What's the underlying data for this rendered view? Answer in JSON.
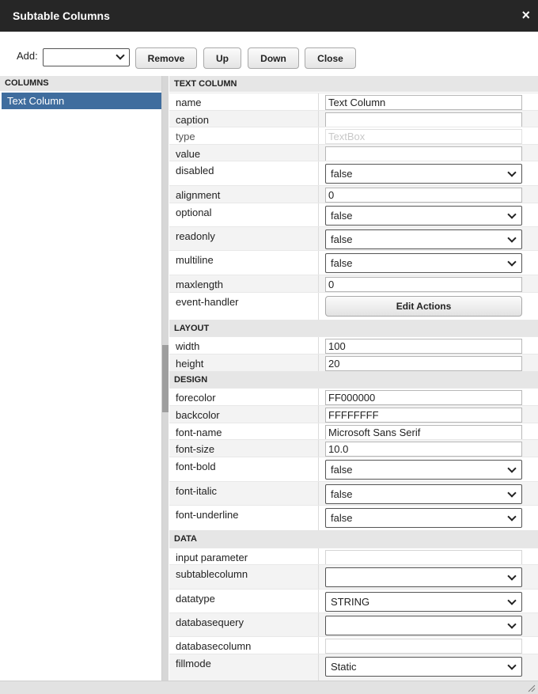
{
  "window": {
    "title": "Subtable Columns",
    "close_glyph": "×"
  },
  "toolbar": {
    "add_label": "Add:",
    "add_value": "",
    "remove_label": "Remove",
    "up_label": "Up",
    "down_label": "Down",
    "close_label": "Close"
  },
  "columns_panel": {
    "header": "COLUMNS",
    "selected_item": "Text Column"
  },
  "sections": {
    "text_column": "TEXT COLUMN",
    "layout": "LAYOUT",
    "design": "DESIGN",
    "data": "DATA"
  },
  "props": {
    "name": {
      "label": "name",
      "value": "Text Column"
    },
    "caption": {
      "label": "caption",
      "value": ""
    },
    "type": {
      "label": "type",
      "value": "TextBox"
    },
    "value": {
      "label": "value",
      "value": ""
    },
    "disabled": {
      "label": "disabled",
      "value": "false"
    },
    "alignment": {
      "label": "alignment",
      "value": "0"
    },
    "optional": {
      "label": "optional",
      "value": "false"
    },
    "readonly": {
      "label": "readonly",
      "value": "false"
    },
    "multiline": {
      "label": "multiline",
      "value": "false"
    },
    "maxlength": {
      "label": "maxlength",
      "value": "0"
    },
    "event_handler": {
      "label": "event-handler",
      "button": "Edit Actions"
    },
    "width": {
      "label": "width",
      "value": "100"
    },
    "height": {
      "label": "height",
      "value": "20"
    },
    "forecolor": {
      "label": "forecolor",
      "value": "FF000000"
    },
    "backcolor": {
      "label": "backcolor",
      "value": "FFFFFFFF"
    },
    "font_name": {
      "label": "font-name",
      "value": "Microsoft Sans Serif"
    },
    "font_size": {
      "label": "font-size",
      "value": "10.0"
    },
    "font_bold": {
      "label": "font-bold",
      "value": "false"
    },
    "font_italic": {
      "label": "font-italic",
      "value": "false"
    },
    "font_underline": {
      "label": "font-underline",
      "value": "false"
    },
    "input_parameter": {
      "label": "input parameter",
      "value": ""
    },
    "subtablecolumn": {
      "label": "subtablecolumn",
      "value": ""
    },
    "datatype": {
      "label": "datatype",
      "value": "STRING"
    },
    "databasequery": {
      "label": "databasequery",
      "value": ""
    },
    "databasecolumn": {
      "label": "databasecolumn",
      "value": ""
    },
    "fillmode": {
      "label": "fillmode",
      "value": "Static"
    }
  },
  "colors": {
    "titlebar": "#262626",
    "selection": "#3f6d9e",
    "section_bg": "#e6e6e6"
  }
}
